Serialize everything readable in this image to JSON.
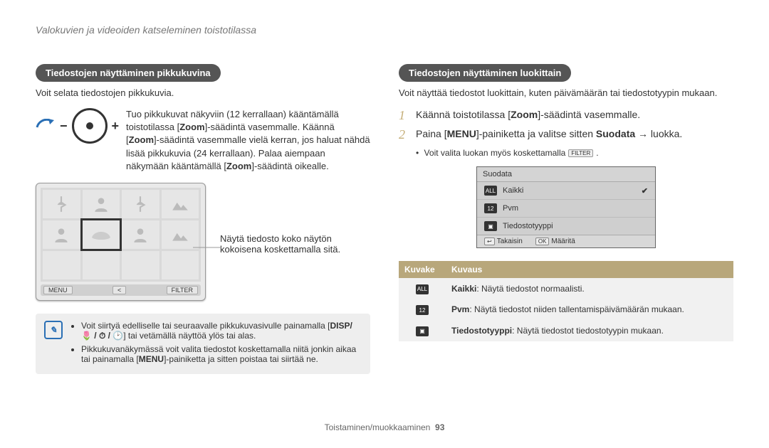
{
  "page_title": "Valokuvien ja videoiden katseleminen toistotilassa",
  "left": {
    "heading": "Tiedostojen näyttäminen pikkukuvina",
    "intro": "Voit selata tiedostojen pikkukuvia.",
    "zoom_para_pre": "Tuo pikkukuvat näkyviin (12 kerrallaan) kääntämällä toistotilassa [",
    "zoom_b1": "Zoom",
    "zoom_mid1": "]-säädintä vasemmalle. Käännä [",
    "zoom_b2": "Zoom",
    "zoom_mid2": "]-säädintä vasemmalle vielä kerran, jos haluat nähdä lisää pikkukuvia (24 kerrallaan). Palaa aiempaan näkymään kääntämällä [",
    "zoom_b3": "Zoom",
    "zoom_post": "]-säädintä oikealle.",
    "screen_bar": {
      "menu": "MENU",
      "share": "<",
      "filter": "FILTER"
    },
    "callout": "Näytä tiedosto koko näytön kokoisena koskettamalla sitä.",
    "note_line1_pre": "Voit siirtyä edelliselle tai seuraavalle pikkukuvasivulle painamalla [",
    "note_line1_btns": "DISP/ 🌷 / ⏱ / 🕑",
    "note_line1_post": "] tai vetämällä näyttöä ylös tai alas.",
    "note_line2_pre": "Pikkukuvanäkymässä voit valita tiedostot koskettamalla niitä jonkin aikaa tai painamalla [",
    "note_line2_btn": "MENU",
    "note_line2_post": "]-painiketta ja sitten poistaa tai siirtää ne."
  },
  "right": {
    "heading": "Tiedostojen näyttäminen luokittain",
    "intro": "Voit näyttää tiedostot luokittain, kuten päivämäärän tai tiedostotyypin mukaan.",
    "step1_pre": "Käännä toistotilassa [",
    "step1_b": "Zoom",
    "step1_post": "]-säädintä vasemmalle.",
    "step2_pre": "Paina [",
    "step2_btn": "MENU",
    "step2_mid": "]-painiketta ja valitse sitten ",
    "step2_b": "Suodata",
    "step2_post": " → luokka.",
    "sub_pre": "Voit valita luokan myös koskettamalla ",
    "sub_btn": "FILTER",
    "sub_post": ".",
    "menu": {
      "title": "Suodata",
      "items": [
        "Kaikki",
        "Pvm",
        "Tiedostotyyppi"
      ],
      "back": "Takaisin",
      "ok": "OK",
      "set": "Määritä"
    },
    "table": {
      "h1": "Kuvake",
      "h2": "Kuvaus",
      "rows": [
        {
          "icon": "all",
          "b": "Kaikki",
          "t": ": Näytä tiedostot normaalisti."
        },
        {
          "icon": "date",
          "b": "Pvm",
          "t": ": Näytä tiedostot niiden tallentamispäivämäärän mukaan."
        },
        {
          "icon": "type",
          "b": "Tiedostotyyppi",
          "t": ": Näytä tiedostot tiedostotyypin mukaan."
        }
      ]
    }
  },
  "footer": {
    "section": "Toistaminen/muokkaaminen",
    "page": "93"
  }
}
